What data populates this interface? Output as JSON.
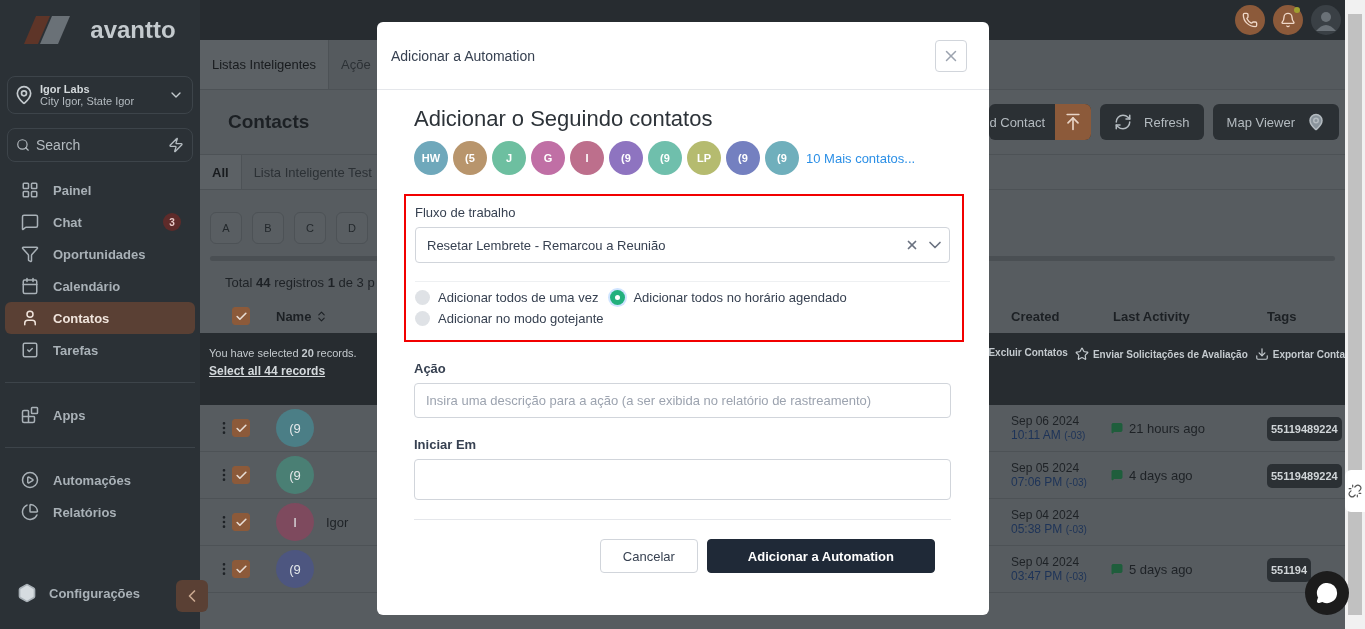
{
  "sidebar": {
    "logo": "avantto",
    "location": {
      "name": "Igor Labs",
      "address": "City Igor, State Igor"
    },
    "search": {
      "placeholder": "Search"
    },
    "groups": [
      [
        {
          "label": "Painel",
          "selected": false
        },
        {
          "label": "Chat",
          "selected": false,
          "badge": "3"
        },
        {
          "label": "Oportunidades",
          "selected": false
        },
        {
          "label": "Calendário",
          "selected": false
        },
        {
          "label": "Contatos",
          "selected": true
        },
        {
          "label": "Tarefas",
          "selected": false
        }
      ],
      [
        {
          "label": "Apps",
          "selected": false
        }
      ],
      [
        {
          "label": "Automações",
          "selected": false
        },
        {
          "label": "Relatórios",
          "selected": false
        }
      ]
    ],
    "settings": "Configurações"
  },
  "top_tabs": [
    {
      "label": "Listas Inteligentes",
      "selected": true
    },
    {
      "label": "Açõe",
      "selected": false
    }
  ],
  "page": {
    "title": "Contacts",
    "buttons": [
      {
        "label": "d Contact",
        "kind": "split"
      },
      {
        "label": "Refresh",
        "kind": "refresh"
      },
      {
        "label": "Map Viewer",
        "kind": "map"
      }
    ]
  },
  "smart_lists": [
    {
      "label": "All",
      "selected": true
    },
    {
      "label": "Lista Inteligente Test",
      "selected": false
    }
  ],
  "letters": [
    "A",
    "B",
    "C",
    "D"
  ],
  "total": "Total **44** registros **1** de 3 p",
  "table": {
    "select_all_checked": true,
    "name_column": "Name",
    "right_columns": [
      "Created",
      "Last Activity",
      "Tags"
    ],
    "selection": {
      "message": "You have selected **20** records.",
      "link": "Select all 44 records",
      "actions": [
        "Excluir Contatos",
        "Enviar Solicitações de Avaliação",
        "Exportar Conta"
      ]
    },
    "rows": [
      {
        "checked": true,
        "avatar": "(9",
        "color": "#4b7e86",
        "name": "",
        "date": "Sep 06 2024",
        "time": "10:11 AM",
        "tz": "(-03)",
        "activity": "21 hours ago",
        "tag": "55119489224"
      },
      {
        "checked": true,
        "avatar": "(9",
        "color": "#4a7f74",
        "name": "",
        "date": "Sep 05 2024",
        "time": "07:06 PM",
        "tz": "(-03)",
        "activity": "4 days ago",
        "tag": "55119489224"
      },
      {
        "checked": true,
        "avatar": "I",
        "color": "#7e4a5e",
        "name": "Igor",
        "date": "Sep 04 2024",
        "time": "05:38 PM",
        "tz": "(-03)",
        "activity": "",
        "tag": ""
      },
      {
        "checked": true,
        "avatar": "(9",
        "color": "#4d5680",
        "name": "",
        "date": "Sep 04 2024",
        "time": "03:47 PM",
        "tz": "(-03)",
        "activity": "5 days ago",
        "tag": "551194"
      }
    ]
  },
  "modal": {
    "title": "Adicionar a Automation",
    "heading": "Adicionar o Seguindo contatos",
    "contacts": [
      {
        "initials": "HW",
        "color": "#6fa8bb"
      },
      {
        "initials": "(5",
        "color": "#b8956c"
      },
      {
        "initials": "J",
        "color": "#6dbfa0"
      },
      {
        "initials": "G",
        "color": "#c06fa5"
      },
      {
        "initials": "I",
        "color": "#bd6f8c"
      },
      {
        "initials": "(9",
        "color": "#8e74c0"
      },
      {
        "initials": "(9",
        "color": "#6fbfac"
      },
      {
        "initials": "LP",
        "color": "#b5bb6f"
      },
      {
        "initials": "(9",
        "color": "#7480c0"
      },
      {
        "initials": "(9",
        "color": "#6fafbc"
      }
    ],
    "more_link": "10 Mais contatos...",
    "workflow": {
      "label": "Fluxo de trabalho",
      "value": "Resetar Lembrete - Remarcou a Reunião",
      "highlighted": true
    },
    "modes": [
      {
        "label": "Adicionar todos de uma vez",
        "selected": false
      },
      {
        "label": "Adicionar todos no horário agendado",
        "selected": true
      },
      {
        "label": "Adicionar no modo gotejante",
        "selected": false
      }
    ],
    "action": {
      "label": "Ação",
      "placeholder": "Insira uma descrição para a ação (a ser exibida no relatório de rastreamento)"
    },
    "start": {
      "label": "Iniciar Em"
    },
    "buttons": [
      {
        "label": "Cancelar",
        "kind": "secondary"
      },
      {
        "label": "Adicionar a Automation",
        "kind": "primary"
      }
    ]
  }
}
